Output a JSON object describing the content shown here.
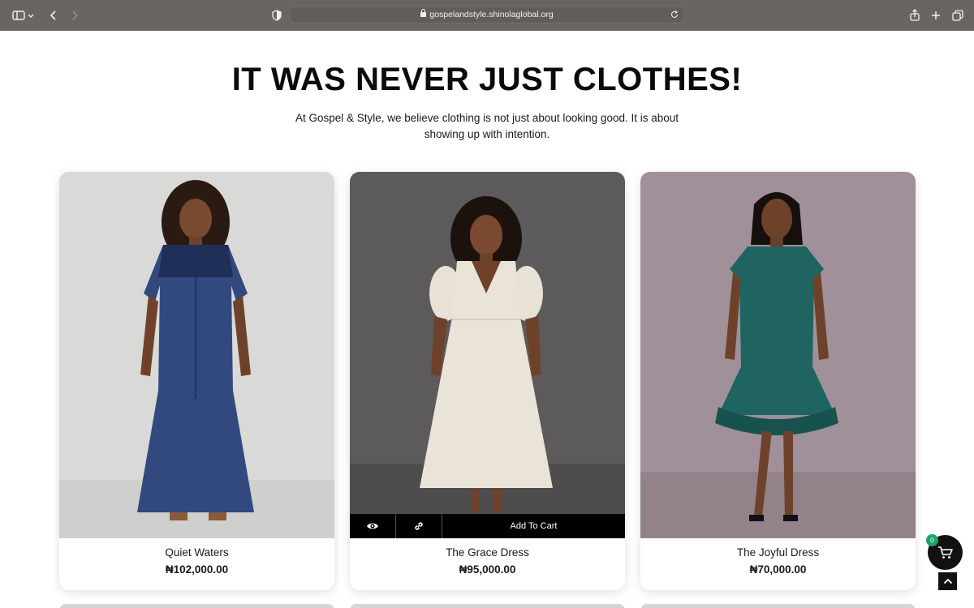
{
  "browser": {
    "url": "gospelandstyle.shinolaglobal.org"
  },
  "hero": {
    "title": "IT WAS NEVER JUST CLOTHES!",
    "subtitle_line1": "At Gospel & Style, we believe clothing is not just about looking good. It is about",
    "subtitle_line2": "showing up with intention."
  },
  "products": [
    {
      "name": "Quiet Waters",
      "price": "₦102,000.00",
      "dress_color": "#2f4a7e",
      "bg_color": "#d8d8d8"
    },
    {
      "name": "The Grace Dress",
      "price": "₦95,000.00",
      "dress_color": "#e9e2d6",
      "bg_color": "#5b5858"
    },
    {
      "name": "The Joyful Dress",
      "price": "₦70,000.00",
      "dress_color": "#1f6460",
      "bg_color": "#9f8f93"
    }
  ],
  "hover_actions": {
    "add_to_cart_label": "Add To Cart",
    "quick_view_icon": "eye-icon",
    "link_icon": "link-icon"
  },
  "cart": {
    "count": "0",
    "accent": "#1aa56a"
  }
}
